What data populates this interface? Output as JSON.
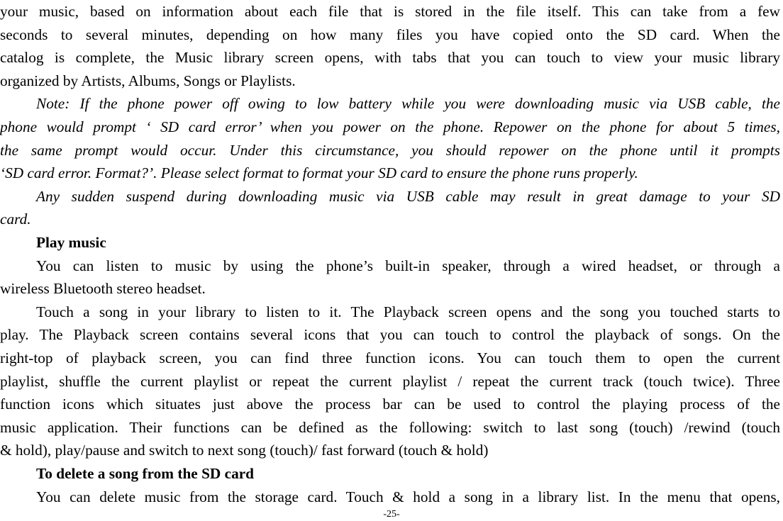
{
  "document": {
    "paragraphs": [
      {
        "id": "catalog-paragraph",
        "style": "normal",
        "lines": [
          "your music, based on information about each file that is stored in the file itself. This can take from a few",
          "seconds to several minutes, depending on how many files you have copied onto the SD card. When the",
          "catalog is complete, the Music library screen opens, with tabs that you can touch to view your music library",
          "organized by Artists, Albums, Songs or Playlists."
        ]
      },
      {
        "id": "note-paragraph",
        "style": "italic",
        "lines": [
          "Note: If the phone power off owing to low battery while you were downloading music via USB cable, the",
          "phone would prompt ‘ SD card error’ when you power on the phone. Repower on the phone for about 5 times,",
          "the same prompt would occur. Under this circumstance, you should repower on the phone until it prompts",
          "‘SD card error. Format?’. Please select format to format your SD card to ensure the phone runs properly."
        ]
      },
      {
        "id": "warning-paragraph",
        "style": "italic",
        "lines": [
          "Any sudden suspend during downloading music via USB cable may result in great damage to your SD",
          "card."
        ]
      },
      {
        "id": "play-music-heading",
        "style": "bold",
        "lines": [
          "Play music"
        ]
      },
      {
        "id": "listen-paragraph",
        "style": "normal",
        "lines": [
          "You can listen to music by using the phone’s built-in speaker, through a wired headset, or through a",
          "wireless Bluetooth stereo headset."
        ]
      },
      {
        "id": "playback-paragraph",
        "style": "normal",
        "lines": [
          "Touch a song in your library to listen to it. The Playback screen opens and the song you touched starts to",
          "play. The Playback screen contains several icons that you can touch to control the playback of songs. On the",
          "right-top of playback screen, you can find three function icons. You can touch them to open the current",
          "playlist, shuffle the current playlist or repeat the current playlist / repeat the current track (touch twice). Three",
          "function icons which situates just above the process bar can be used to control the playing process of the",
          "music application. Their functions can be defined as the following: switch to last song (touch) /rewind (touch",
          "& hold), play/pause and switch to next song (touch)/ fast forward (touch & hold)"
        ]
      },
      {
        "id": "delete-heading",
        "style": "bold",
        "lines": [
          "To delete a song from the SD card"
        ]
      },
      {
        "id": "delete-paragraph",
        "style": "normal",
        "lines": [
          "You can delete music from the storage card. Touch & hold a song in a library list. In the menu that opens,"
        ]
      }
    ],
    "page_number": "-25-"
  }
}
